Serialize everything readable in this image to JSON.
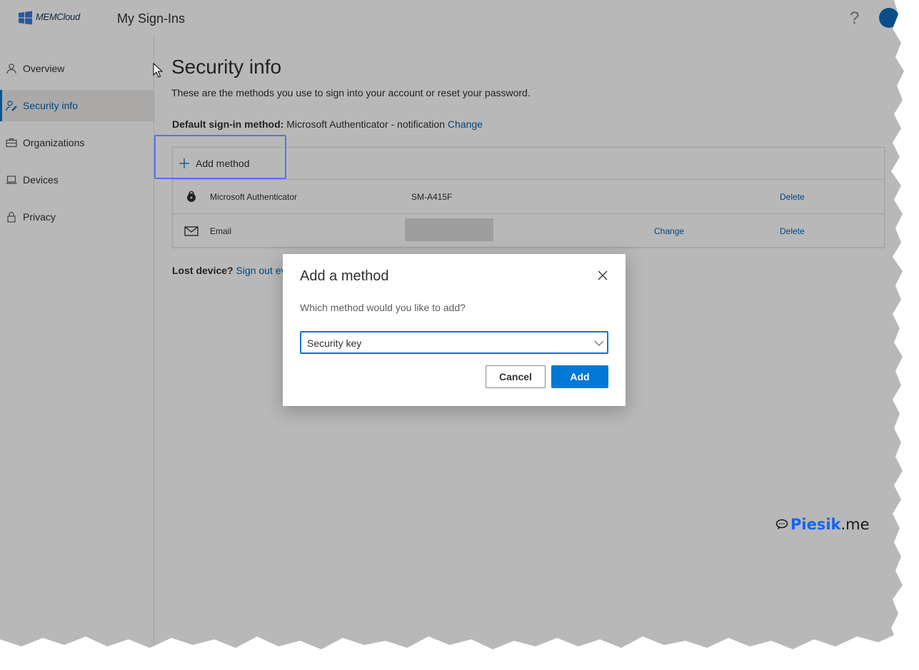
{
  "header": {
    "logo_text": "MEMCloud",
    "app_title": "My Sign-Ins",
    "help_icon": "?"
  },
  "sidebar": {
    "items": [
      {
        "label": "Overview",
        "icon": "person-icon"
      },
      {
        "label": "Security info",
        "icon": "person-key-icon",
        "active": true
      },
      {
        "label": "Organizations",
        "icon": "briefcase-icon"
      },
      {
        "label": "Devices",
        "icon": "laptop-icon"
      },
      {
        "label": "Privacy",
        "icon": "lock-icon"
      }
    ]
  },
  "main": {
    "title": "Security info",
    "description": "These are the methods you use to sign into your account or reset your password.",
    "default_label": "Default sign-in method:",
    "default_value": "Microsoft Authenticator - notification",
    "default_change": "Change",
    "add_method": "Add method",
    "methods": [
      {
        "name": "Microsoft Authenticator",
        "detail": "SM-A415F",
        "change": "",
        "delete": "Delete"
      },
      {
        "name": "Email",
        "detail": "",
        "change": "Change",
        "delete": "Delete"
      }
    ],
    "lost_device_label": "Lost device?",
    "lost_device_link": "Sign out eve"
  },
  "dialog": {
    "title": "Add a method",
    "question": "Which method would you like to add?",
    "selected_method": "Security key",
    "cancel_label": "Cancel",
    "add_label": "Add"
  },
  "watermark": {
    "blue": "Piesik",
    "black": ".me"
  },
  "colors": {
    "accent": "#0078d4",
    "link": "#0063b1",
    "highlight": "#5b6ef5"
  }
}
